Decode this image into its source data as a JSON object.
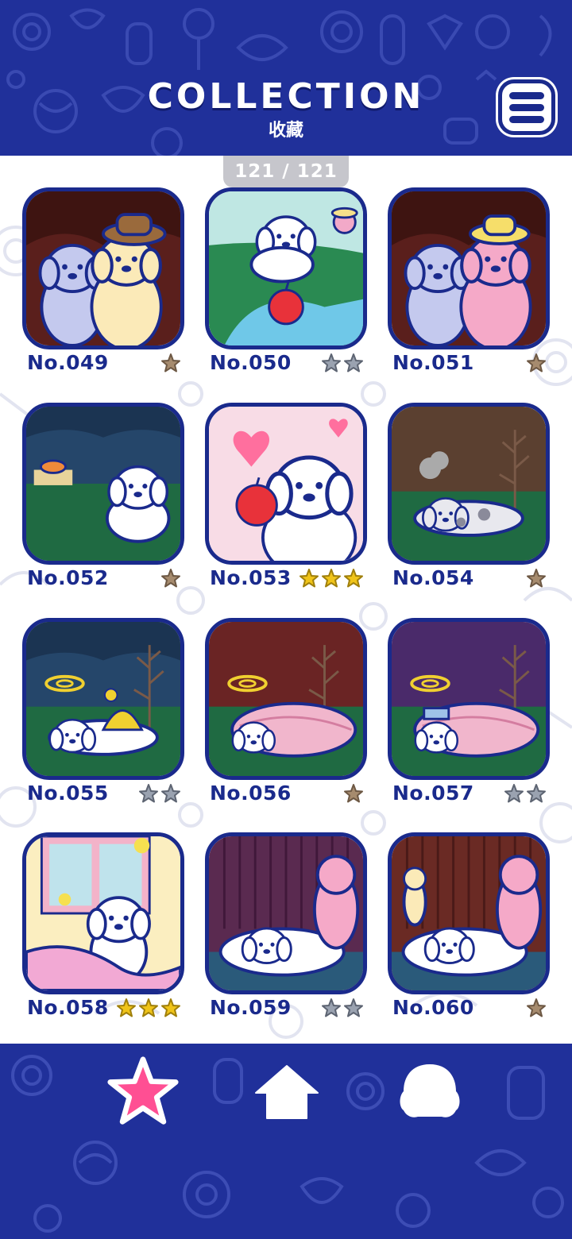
{
  "header": {
    "title": "COLLECTION",
    "subtitle": "收藏",
    "menu_icon": "hamburger-menu-icon"
  },
  "counter": "121 / 121",
  "colors": {
    "navy": "#1a2a8c",
    "header_bg": "#20309a",
    "star_brown": "#a68b6e",
    "star_gray": "#9aa2b0",
    "star_gold": "#f0c419",
    "nav_star_pink": "#ff4f93"
  },
  "cards": [
    {
      "number": "No.049",
      "stars": 1,
      "star_color": "brown",
      "scene": "dogs hugging in brown room, cream dog with brown hat"
    },
    {
      "number": "No.050",
      "stars": 2,
      "star_color": "gray",
      "scene": "white dog falling into stream with red apple"
    },
    {
      "number": "No.051",
      "stars": 1,
      "star_color": "brown",
      "scene": "dogs hugging, pink poodle with yellow hat"
    },
    {
      "number": "No.052",
      "stars": 1,
      "star_color": "brown",
      "scene": "white dog at night with apple core and cat"
    },
    {
      "number": "No.053",
      "stars": 3,
      "star_color": "gold",
      "scene": "white dog holding red apple with hearts"
    },
    {
      "number": "No.054",
      "stars": 1,
      "star_color": "brown",
      "scene": "gray spotted dog lying down by tree"
    },
    {
      "number": "No.055",
      "stars": 2,
      "star_color": "gray",
      "scene": "dizzy dog with umbrella at night"
    },
    {
      "number": "No.056",
      "stars": 1,
      "star_color": "brown",
      "scene": "dizzy dog under pink blanket, red sky"
    },
    {
      "number": "No.057",
      "stars": 2,
      "star_color": "gray",
      "scene": "dizzy dog with blue hat under pink blanket, purple sky"
    },
    {
      "number": "No.058",
      "stars": 3,
      "star_color": "gold",
      "scene": "dog stretching in bed by window"
    },
    {
      "number": "No.059",
      "stars": 2,
      "star_color": "gray",
      "scene": "white dog lying in rain with pink poodle"
    },
    {
      "number": "No.060",
      "stars": 1,
      "star_color": "brown",
      "scene": "white dog lying in rain with pink poodle and cream dog"
    }
  ],
  "bottom_nav": [
    {
      "name": "collection-tab",
      "icon": "star-icon",
      "active": true
    },
    {
      "name": "home-tab",
      "icon": "home-icon",
      "active": false
    },
    {
      "name": "character-tab",
      "icon": "dog-head-icon",
      "active": false
    }
  ]
}
